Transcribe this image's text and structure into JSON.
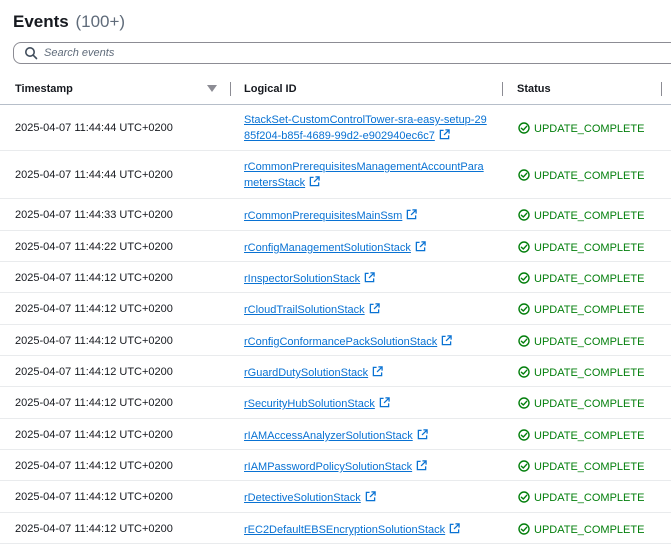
{
  "header": {
    "title": "Events",
    "count": "(100+)"
  },
  "search": {
    "placeholder": "Search events"
  },
  "columns": {
    "timestamp": "Timestamp",
    "logical_id": "Logical ID",
    "status": "Status"
  },
  "rows": [
    {
      "timestamp": "2025-04-07 11:44:44 UTC+0200",
      "logical_id": "StackSet-CustomControlTower-sra-easy-setup-2985f204-b85f-4689-99d2-e902940ec6c7",
      "status": "UPDATE_COMPLETE"
    },
    {
      "timestamp": "2025-04-07 11:44:44 UTC+0200",
      "logical_id": "rCommonPrerequisitesManagementAccountParametersStack",
      "status": "UPDATE_COMPLETE"
    },
    {
      "timestamp": "2025-04-07 11:44:33 UTC+0200",
      "logical_id": "rCommonPrerequisitesMainSsm",
      "status": "UPDATE_COMPLETE"
    },
    {
      "timestamp": "2025-04-07 11:44:22 UTC+0200",
      "logical_id": "rConfigManagementSolutionStack",
      "status": "UPDATE_COMPLETE"
    },
    {
      "timestamp": "2025-04-07 11:44:12 UTC+0200",
      "logical_id": "rInspectorSolutionStack",
      "status": "UPDATE_COMPLETE"
    },
    {
      "timestamp": "2025-04-07 11:44:12 UTC+0200",
      "logical_id": "rCloudTrailSolutionStack",
      "status": "UPDATE_COMPLETE"
    },
    {
      "timestamp": "2025-04-07 11:44:12 UTC+0200",
      "logical_id": "rConfigConformancePackSolutionStack",
      "status": "UPDATE_COMPLETE"
    },
    {
      "timestamp": "2025-04-07 11:44:12 UTC+0200",
      "logical_id": "rGuardDutySolutionStack",
      "status": "UPDATE_COMPLETE"
    },
    {
      "timestamp": "2025-04-07 11:44:12 UTC+0200",
      "logical_id": "rSecurityHubSolutionStack",
      "status": "UPDATE_COMPLETE"
    },
    {
      "timestamp": "2025-04-07 11:44:12 UTC+0200",
      "logical_id": "rIAMAccessAnalyzerSolutionStack",
      "status": "UPDATE_COMPLETE"
    },
    {
      "timestamp": "2025-04-07 11:44:12 UTC+0200",
      "logical_id": "rIAMPasswordPolicySolutionStack",
      "status": "UPDATE_COMPLETE"
    },
    {
      "timestamp": "2025-04-07 11:44:12 UTC+0200",
      "logical_id": "rDetectiveSolutionStack",
      "status": "UPDATE_COMPLETE"
    },
    {
      "timestamp": "2025-04-07 11:44:12 UTC+0200",
      "logical_id": "rEC2DefaultEBSEncryptionSolutionStack",
      "status": "UPDATE_COMPLETE"
    }
  ],
  "colors": {
    "link": "#0972d3",
    "success": "#037f0c",
    "text": "#16191f",
    "muted": "#5f6b7a"
  },
  "icons": {
    "search": "search-icon",
    "sort": "sort-down-icon",
    "external": "external-link-icon",
    "status": "success-check-icon"
  }
}
